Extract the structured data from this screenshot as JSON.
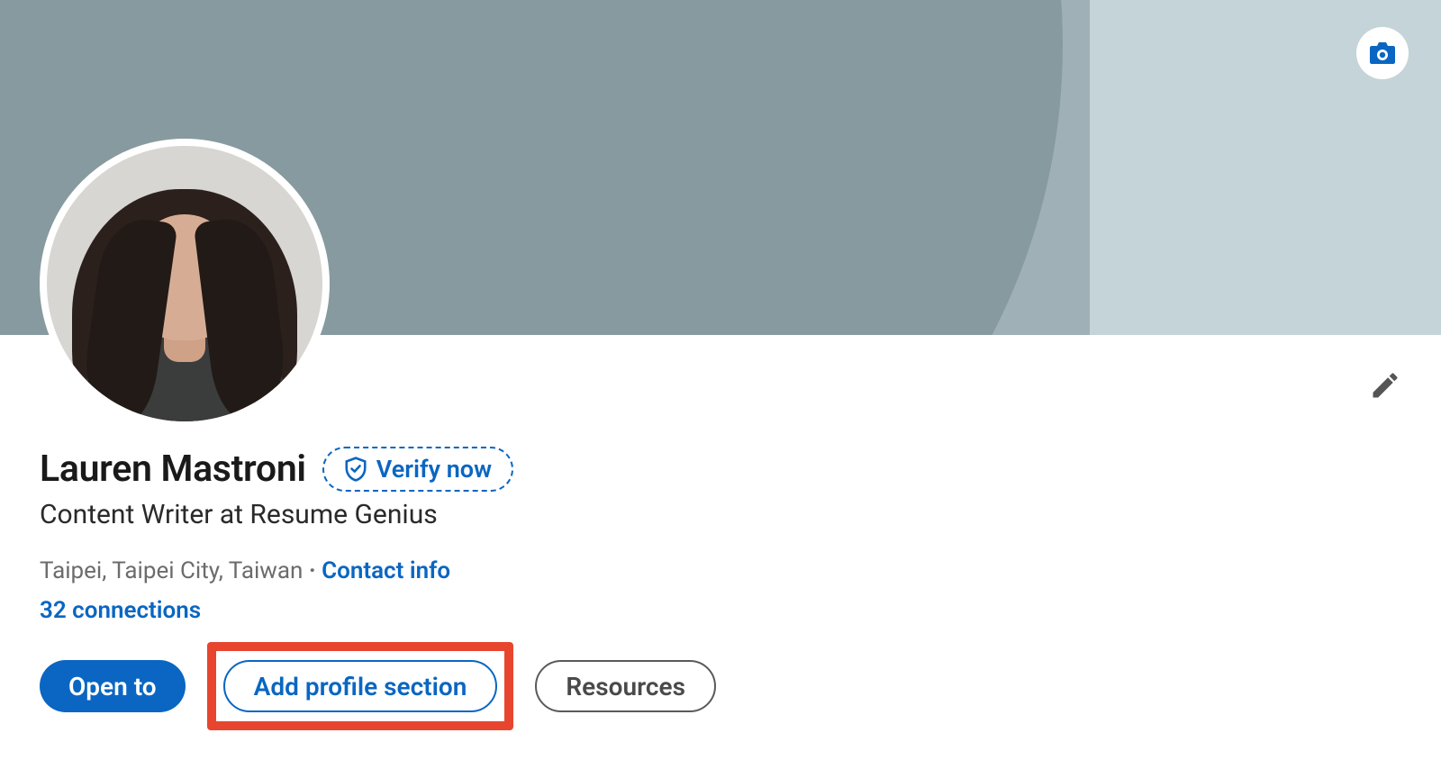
{
  "profile": {
    "name": "Lauren Mastroni",
    "headline": "Content Writer at Resume Genius",
    "location": "Taipei, Taipei City, Taiwan",
    "contact_info_label": "Contact info",
    "connections_label": "32 connections",
    "verify_label": "Verify now"
  },
  "buttons": {
    "open_to": "Open to",
    "add_profile_section": "Add profile section",
    "resources": "Resources"
  },
  "icons": {
    "camera": "camera-icon",
    "pencil": "pencil-icon",
    "shield": "shield-icon"
  }
}
